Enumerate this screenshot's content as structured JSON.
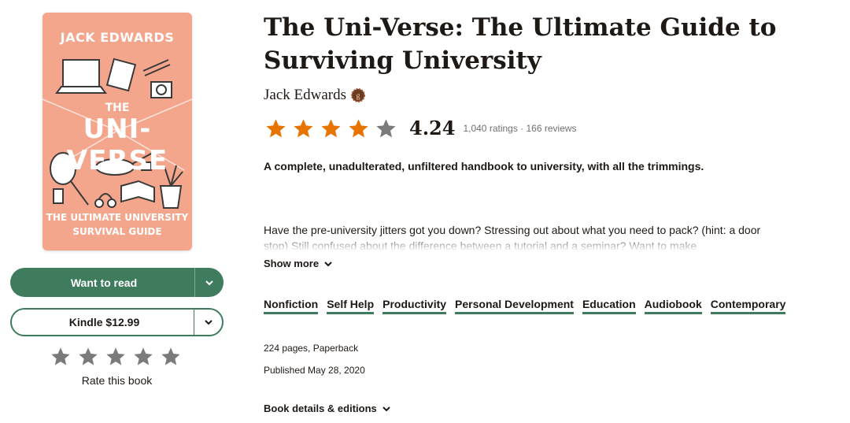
{
  "cover": {
    "author": "JACK EDWARDS",
    "the": "THE",
    "title": "UNI-VERSE",
    "subtitle_line1": "THE ULTIMATE UNIVERSITY",
    "subtitle_line2": "SURVIVAL GUIDE",
    "background_color": "#f4a68d"
  },
  "actions": {
    "want_to_read": "Want to read",
    "kindle": "Kindle $12.99",
    "rate_label": "Rate this book",
    "accent_color": "#3f7c5e"
  },
  "book": {
    "title": "The Uni-Verse: The Ultimate Guide to Surviving University",
    "author": "Jack Edwards",
    "author_badge_icon": "goodreads-author-badge-icon",
    "rating": {
      "average": "4.24",
      "stars_filled": 4,
      "stars_total": 5,
      "counts": "1,040 ratings · 166 reviews",
      "star_color": "#e87400"
    },
    "tagline": "A complete, unadulterated, unfiltered handbook to university, with all the trimmings.",
    "description": "Have the pre-university jitters got you down? Stressing out about what you need to pack? (hint: a door stop) Still confused about the difference between a tutorial and a seminar? Want to make",
    "show_more": "Show more",
    "genres": [
      "Nonfiction",
      "Self Help",
      "Productivity",
      "Personal Development",
      "Education",
      "Audiobook",
      "Contemporary"
    ],
    "pages_format": "224 pages, Paperback",
    "published": "Published May 28, 2020",
    "details_link": "Book details & editions"
  }
}
